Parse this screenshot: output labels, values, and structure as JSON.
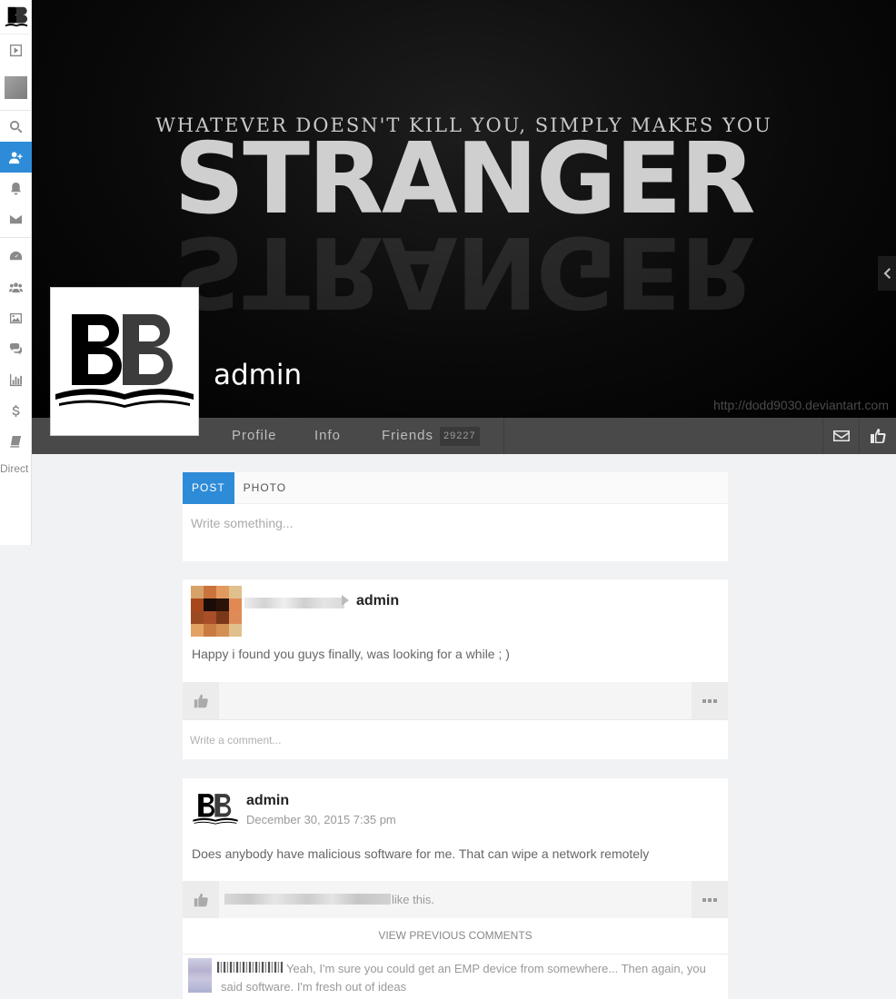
{
  "sidebar": {
    "items": [
      {
        "icon": "play-icon"
      },
      {
        "icon": "search-icon"
      },
      {
        "icon": "add-user-icon",
        "active": true
      },
      {
        "icon": "bell-icon"
      },
      {
        "icon": "envelope-icon"
      },
      {
        "icon": "dashboard-icon"
      },
      {
        "icon": "users-icon"
      },
      {
        "icon": "image-icon"
      },
      {
        "icon": "chat-icon"
      },
      {
        "icon": "bar-chart-icon"
      },
      {
        "icon": "dollar-icon"
      },
      {
        "icon": "book-icon"
      }
    ],
    "bottom_label": "Direct"
  },
  "cover": {
    "tagline": "WHATEVER DOESN'T KILL YOU, SIMPLY MAKES YOU",
    "headline": "STRANGER",
    "credit": "http://dodd9030.deviantart.com"
  },
  "profile": {
    "name": "admin"
  },
  "nav": {
    "tabs": [
      "Profile",
      "Info",
      "Friends"
    ],
    "friends_count": "29227"
  },
  "composer": {
    "tabs": [
      "POST",
      "PHOTO"
    ],
    "placeholder": "Write something..."
  },
  "posts": [
    {
      "author": "admin",
      "body": "Happy i found you guys finally, was looking for a while ; )",
      "comment_placeholder": "Write a comment..."
    },
    {
      "author": "admin",
      "time": "December 30, 2015 7:35 pm",
      "body": "Does anybody have malicious software for me. That can wipe a network remotely",
      "like_text": "like this.",
      "view_previous": "VIEW PREVIOUS COMMENTS",
      "comment": "Yeah, I'm sure you could get an EMP device from somewhere... Then again, you said software. I'm fresh out of ideas"
    }
  ],
  "colors": {
    "accent": "#2e8bd7",
    "navbar": "#494949"
  }
}
